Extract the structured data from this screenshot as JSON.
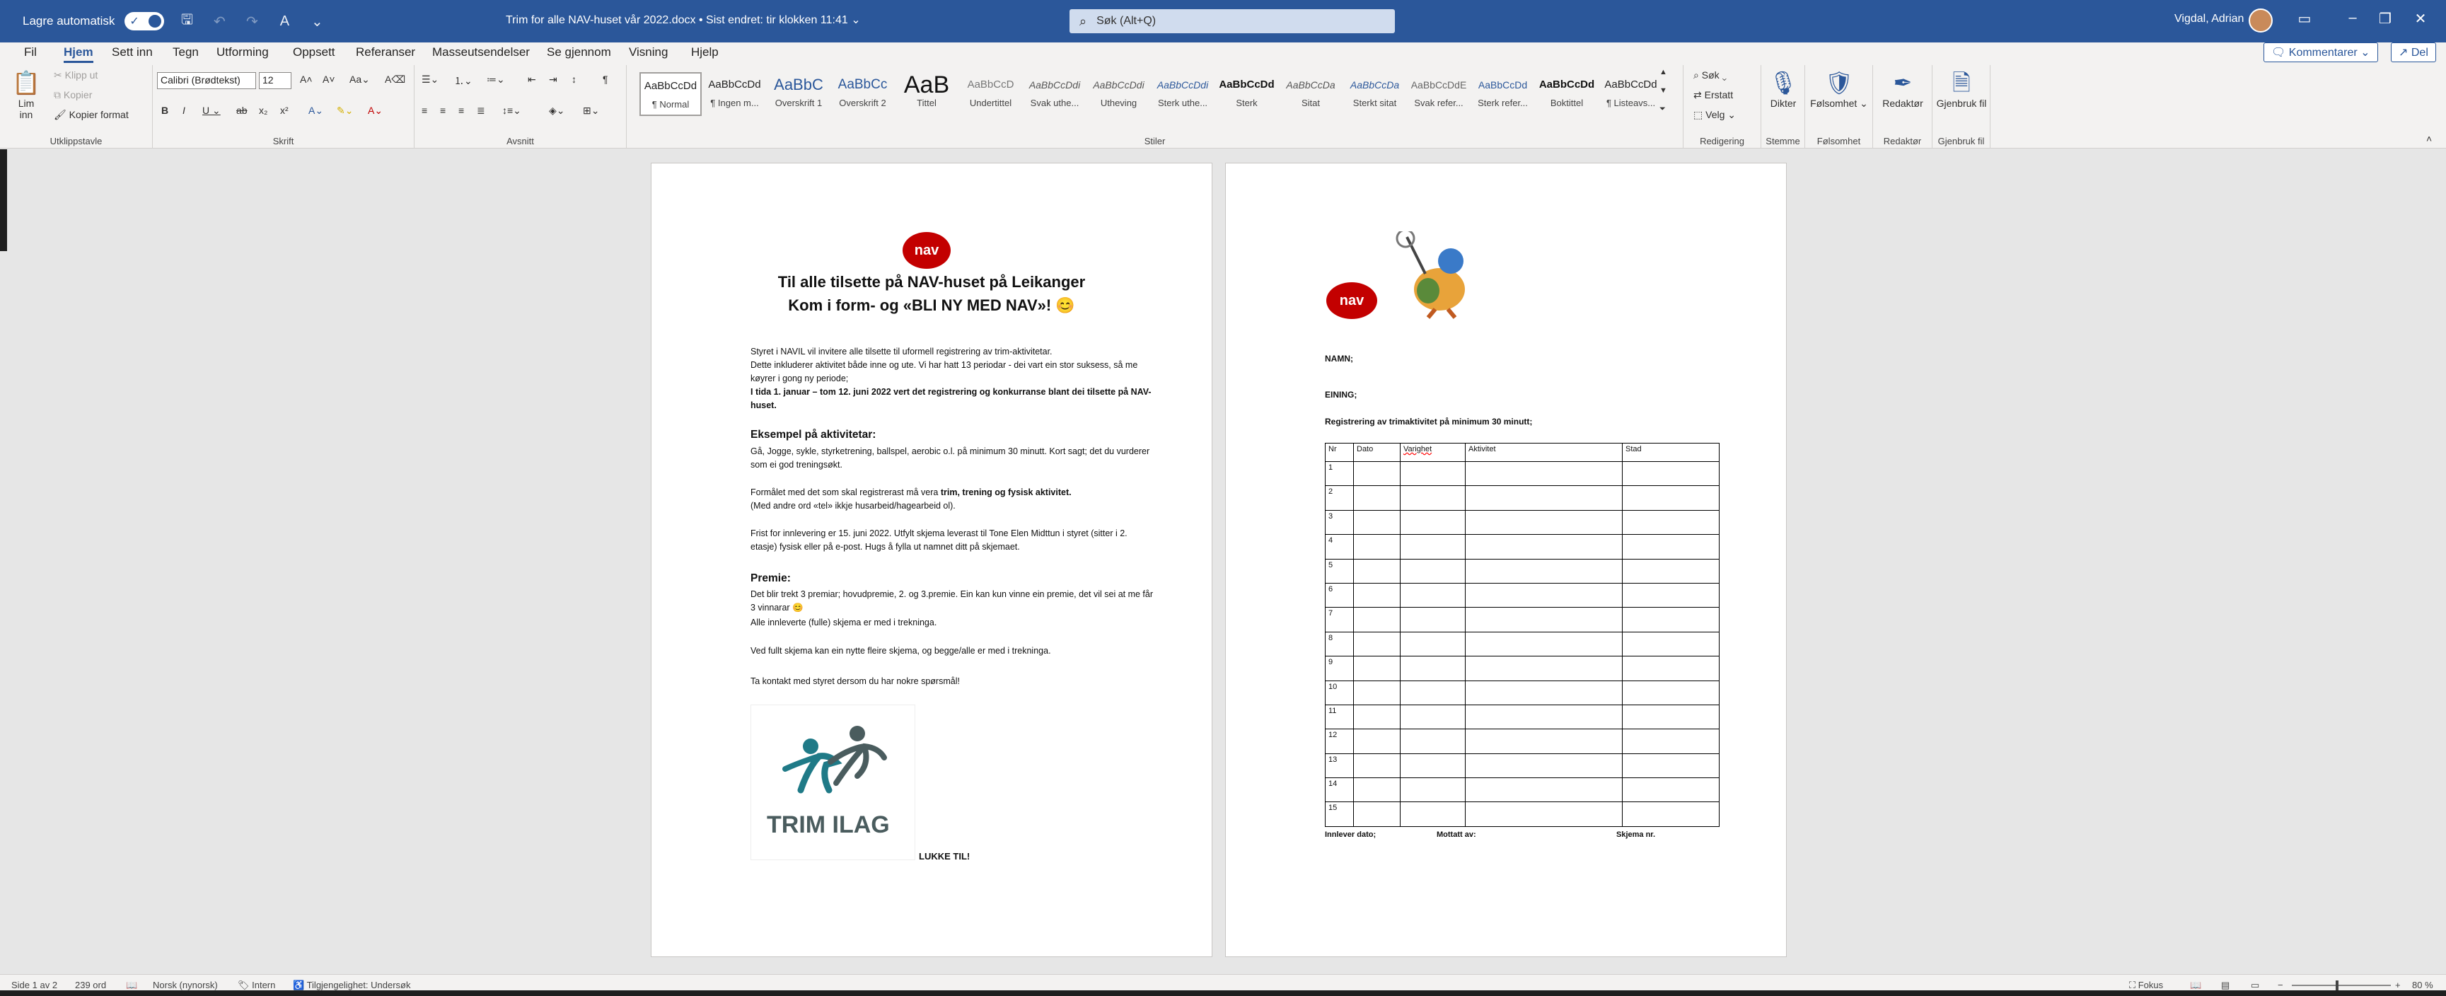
{
  "titlebar": {
    "autosave_label": "Lagre automatisk",
    "autosave_state": "På",
    "doc_title": "Trim for alle NAV-huset vår 2022.docx  •  Sist endret: tir klokken 11:41  ⌄",
    "search_placeholder": "Søk (Alt+Q)",
    "user": "Vigdal, Adrian"
  },
  "tabs": [
    "Fil",
    "Hjem",
    "Sett inn",
    "Tegn",
    "Utforming",
    "Oppsett",
    "Referanser",
    "Masseutsendelser",
    "Se gjennom",
    "Visning",
    "Hjelp"
  ],
  "comments_label": "Kommentarer",
  "share_label": "Del",
  "ribbon": {
    "clipboard": {
      "paste": "Lim inn",
      "cut": "Klipp ut",
      "copy": "Kopier",
      "format_painter": "Kopier format",
      "group": "Utklippstavle"
    },
    "font": {
      "name": "Calibri (Brødtekst)",
      "size": "12",
      "group": "Skrift"
    },
    "paragraph": {
      "group": "Avsnitt"
    },
    "styles": {
      "group": "Stiler",
      "items": [
        {
          "preview": "AaBbCcDd",
          "name": "¶ Normal"
        },
        {
          "preview": "AaBbCcDd",
          "name": "¶ Ingen m..."
        },
        {
          "preview": "AaBbC",
          "name": "Overskrift 1"
        },
        {
          "preview": "AaBbCc",
          "name": "Overskrift 2"
        },
        {
          "preview": "AaB",
          "name": "Tittel"
        },
        {
          "preview": "AaBbCcD",
          "name": "Undertittel"
        },
        {
          "preview": "AaBbCcDdi",
          "name": "Svak uthe..."
        },
        {
          "preview": "AaBbCcDdi",
          "name": "Utheving"
        },
        {
          "preview": "AaBbCcDdi",
          "name": "Sterk uthe..."
        },
        {
          "preview": "AaBbCcDd",
          "name": "Sterk"
        },
        {
          "preview": "AaBbCcDa",
          "name": "Sitat"
        },
        {
          "preview": "AaBbCcDa",
          "name": "Sterkt sitat"
        },
        {
          "preview": "AaBbCcDdE",
          "name": "Svak refer..."
        },
        {
          "preview": "AaBbCcDd",
          "name": "Sterk refer..."
        },
        {
          "preview": "AaBbCcDd",
          "name": "Boktittel"
        },
        {
          "preview": "AaBbCcDd",
          "name": "¶ Listeavs..."
        }
      ]
    },
    "editing": {
      "find": "Søk",
      "replace": "Erstatt",
      "select": "Velg",
      "group": "Redigering"
    },
    "voice": {
      "dictate": "Dikter",
      "group": "Stemme"
    },
    "sensitivity": {
      "label": "Følsomhet",
      "group": "Følsomhet"
    },
    "editor": {
      "label": "Redaktør",
      "group": "Redaktør"
    },
    "reuse": {
      "label": "Gjenbruk fil",
      "group": "Gjenbruk fil"
    }
  },
  "page1": {
    "logo": "nav",
    "title1": "Til alle tilsette på NAV-huset på Leikanger",
    "title2": "Kom i form- og «BLI NY MED NAV»! 😊",
    "intro1": "Styret i NAVIL vil invitere alle tilsette til uformell registrering av trim-aktivitetar.",
    "intro2": "Dette inkluderer aktivitet både inne og ute. Vi har hatt 13 periodar -  dei vart ein stor suksess, så me køyrer i gong ny periode;",
    "intro3": "I tida 1. januar – tom 12. juni 2022 vert det registrering og konkurranse blant dei tilsette på NAV-huset.",
    "h_example": "Eksempel på aktivitetar:",
    "example": "Gå, Jogge, sykle, styrketrening, ballspel, aerobic o.l. på minimum 30 minutt. Kort sagt; det du vurderer som ei god treningsøkt.",
    "purpose_a": "Formålet med det som skal registrerast må vera ",
    "purpose_b": "trim, trening og fysisk aktivitet.",
    "purpose_c": "(Med andre ord «tel» ikkje husarbeid/hagearbeid ol).",
    "deadline": "Frist for innlevering er 15. juni 2022. Utfylt skjema leverast til Tone Elen Midttun i styret (sitter i 2. etasje) fysisk eller på e-post. Hugs å fylla ut namnet ditt på skjemaet.",
    "h_prize": "Premie:",
    "prize1": "Det blir trekt 3 premiar; hovudpremie, 2. og 3.premie. Ein kan kun vinne ein premie, det vil sei at me får 3 vinnarar 😊",
    "prize2": "Alle innleverte (fulle) skjema  er med i trekninga.",
    "full": "Ved fullt skjema kan ein nytte fleire skjema, og begge/alle er med i trekninga.",
    "contact": "Ta kontakt med styret dersom du har nokre spørsmål!",
    "trim_logo": "TRIM ILAG",
    "good_luck": "LUKKE TIL!"
  },
  "page2": {
    "logo": "nav",
    "name": "NAMN;",
    "unit": "EINING;",
    "reg": "Registrering av trimaktivitet på minimum 30 minutt;",
    "columns": [
      "Nr",
      "Dato",
      "Varighet",
      "Aktivitet",
      "Stad"
    ],
    "rows": [
      "1",
      "2",
      "3",
      "4",
      "5",
      "6",
      "7",
      "8",
      "9",
      "10",
      "11",
      "12",
      "13",
      "14",
      "15"
    ],
    "f1": "Innlever dato;",
    "f2": "Mottatt av:",
    "f3": "Skjema nr."
  },
  "status": {
    "page": "Side 1 av 2",
    "words": "239 ord",
    "language": "Norsk (nynorsk)",
    "label": "Intern",
    "accessibility": "Tilgjengelighet: Undersøk",
    "focus": "Fokus",
    "zoom": "80 %"
  }
}
